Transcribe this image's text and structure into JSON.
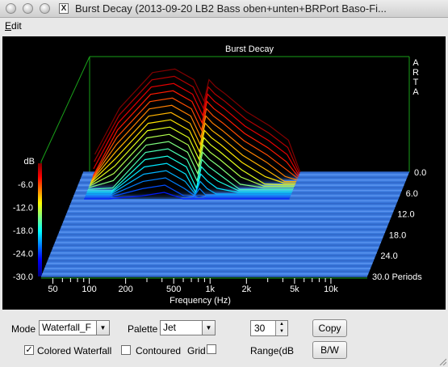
{
  "window": {
    "title": "Burst Decay  (2013-09-20 LB2 Bass oben+unten+BRPort Baso-Fi..."
  },
  "menu": {
    "edit_label": "Edit",
    "edit_mnemonic": "E",
    "edit_rest": "dit"
  },
  "plot": {
    "title": "Burst Decay",
    "brand": [
      "A",
      "R",
      "T",
      "A"
    ],
    "background": "#000000",
    "axis_color": "#19a019",
    "floor_color": "#3a78dc"
  },
  "chart_data": {
    "type": "waterfall",
    "title": "Burst Decay",
    "xlabel": "Frequency (Hz)",
    "x_scale": "log",
    "x_ticks": [
      50,
      100,
      200,
      500,
      1000,
      2000,
      5000,
      10000
    ],
    "x_tick_labels": [
      "50",
      "100",
      "200",
      "500",
      "1k",
      "2k",
      "5k",
      "10k"
    ],
    "ylabel": "dB",
    "y_ticks": [
      "-6.0",
      "-12.0",
      "-18.0",
      "-24.0",
      "-30.0"
    ],
    "ylim": [
      -30,
      0
    ],
    "zlabel": "Periods",
    "z_ticks": [
      "0.0",
      "6.0",
      "12.0",
      "18.0",
      "24.0",
      "30.0 Periods"
    ],
    "zlim": [
      0,
      30
    ],
    "slices": [
      {
        "x": [
          50,
          80,
          150,
          230,
          330,
          400,
          440,
          500,
          600,
          900,
          1400,
          2000,
          2500
        ],
        "y": [
          -25,
          -12,
          -2,
          -1,
          -4,
          -10,
          -4,
          -6,
          -8,
          -13,
          -17,
          -21,
          -30
        ]
      }
    ]
  },
  "controls": {
    "mode_label": "Mode",
    "mode_value": "Waterfall_F",
    "palette_label": "Palette",
    "palette_value": "Jet",
    "range_value": "30",
    "range_label": "Range(dB",
    "copy_label": "Copy",
    "bw_label": "B/W",
    "colored_waterfall_label": "Colored Waterfall",
    "colored_waterfall_checked": "✓",
    "contoured_label": "Contoured",
    "grid_label": "Grid",
    "dropdown_arrow": "▼",
    "spin_up": "▲",
    "spin_down": "▼"
  }
}
